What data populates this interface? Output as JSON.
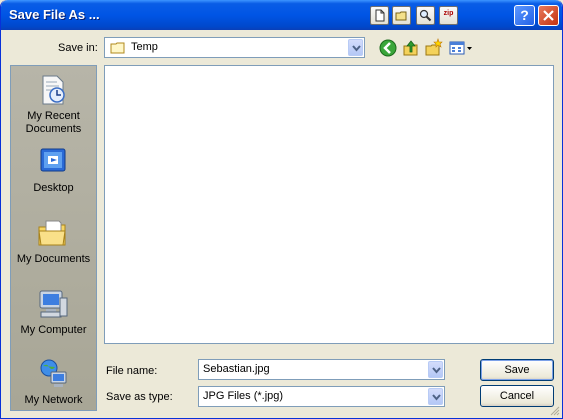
{
  "window": {
    "title": "Save File As ..."
  },
  "title_tools": [
    {
      "name": "new-file-tool",
      "icon": "document-icon",
      "label": ""
    },
    {
      "name": "open-folder-tool",
      "icon": "folder-icon",
      "label": ""
    },
    {
      "name": "search-tool",
      "icon": "magnifier-icon",
      "label": ""
    },
    {
      "name": "zip-tool",
      "icon": "zip-icon",
      "label": "zip"
    }
  ],
  "save_in": {
    "label": "Save in:",
    "value": "Temp",
    "icon": "folder-icon"
  },
  "toolbar": [
    "back-icon",
    "up-folder-icon",
    "new-folder-icon",
    "views-menu-icon"
  ],
  "places": [
    {
      "label": "My Recent Documents",
      "icon": "recent-documents-icon"
    },
    {
      "label": "Desktop",
      "icon": "desktop-icon"
    },
    {
      "label": "My Documents",
      "icon": "my-documents-icon"
    },
    {
      "label": "My Computer",
      "icon": "my-computer-icon"
    },
    {
      "label": "My Network",
      "icon": "my-network-icon"
    }
  ],
  "file_name": {
    "label": "File name:",
    "value": "Sebastian.jpg"
  },
  "save_as_type": {
    "label": "Save as type:",
    "value": "JPG Files (*.jpg)"
  },
  "buttons": {
    "save": "Save",
    "cancel": "Cancel"
  },
  "colors": {
    "title_bar": "#0055e5",
    "dialog_bg": "#ece9d8",
    "field_border": "#7f9db9"
  }
}
